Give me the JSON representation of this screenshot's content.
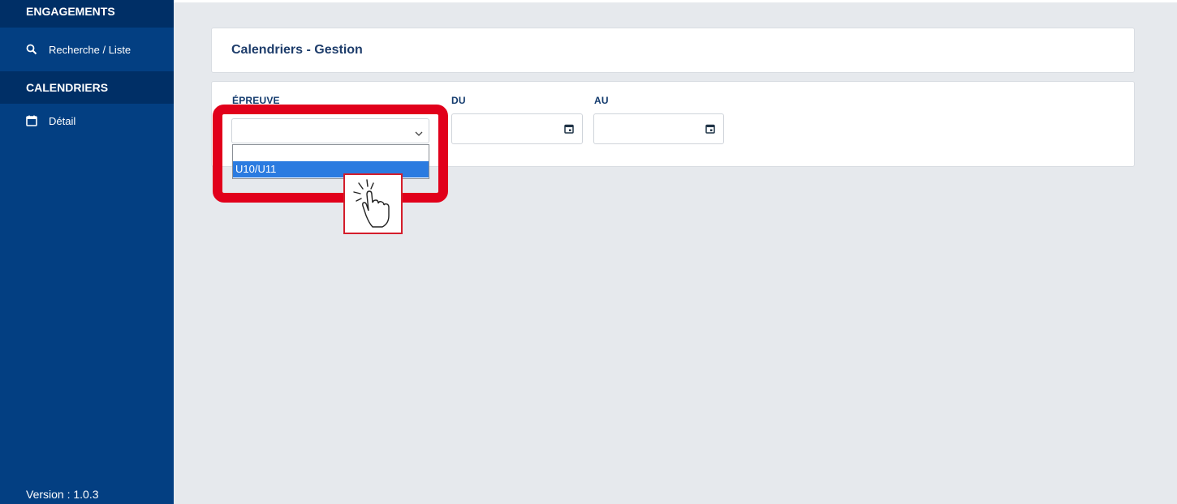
{
  "sidebar": {
    "sections": [
      {
        "label": "ENGAGEMENTS",
        "items": [
          {
            "label": "Recherche / Liste",
            "icon": "search-icon"
          }
        ]
      },
      {
        "label": "CALENDRIERS",
        "items": [
          {
            "label": "Détail",
            "icon": "calendar-icon"
          }
        ]
      }
    ],
    "version": "Version : 1.0.3"
  },
  "header": {
    "title": "Calendriers - Gestion"
  },
  "filters": {
    "epreuve": {
      "label": "ÉPREUVE",
      "value": "",
      "options": [
        "",
        "U10/U11"
      ],
      "highlighted_option": "U10/U11"
    },
    "du": {
      "label": "DU",
      "value": ""
    },
    "au": {
      "label": "AU",
      "value": ""
    }
  },
  "colors": {
    "sidebar": "#033f82",
    "sidebar_section": "#002f66",
    "highlight": "#e1001b",
    "option_selected": "#2b7be0"
  }
}
